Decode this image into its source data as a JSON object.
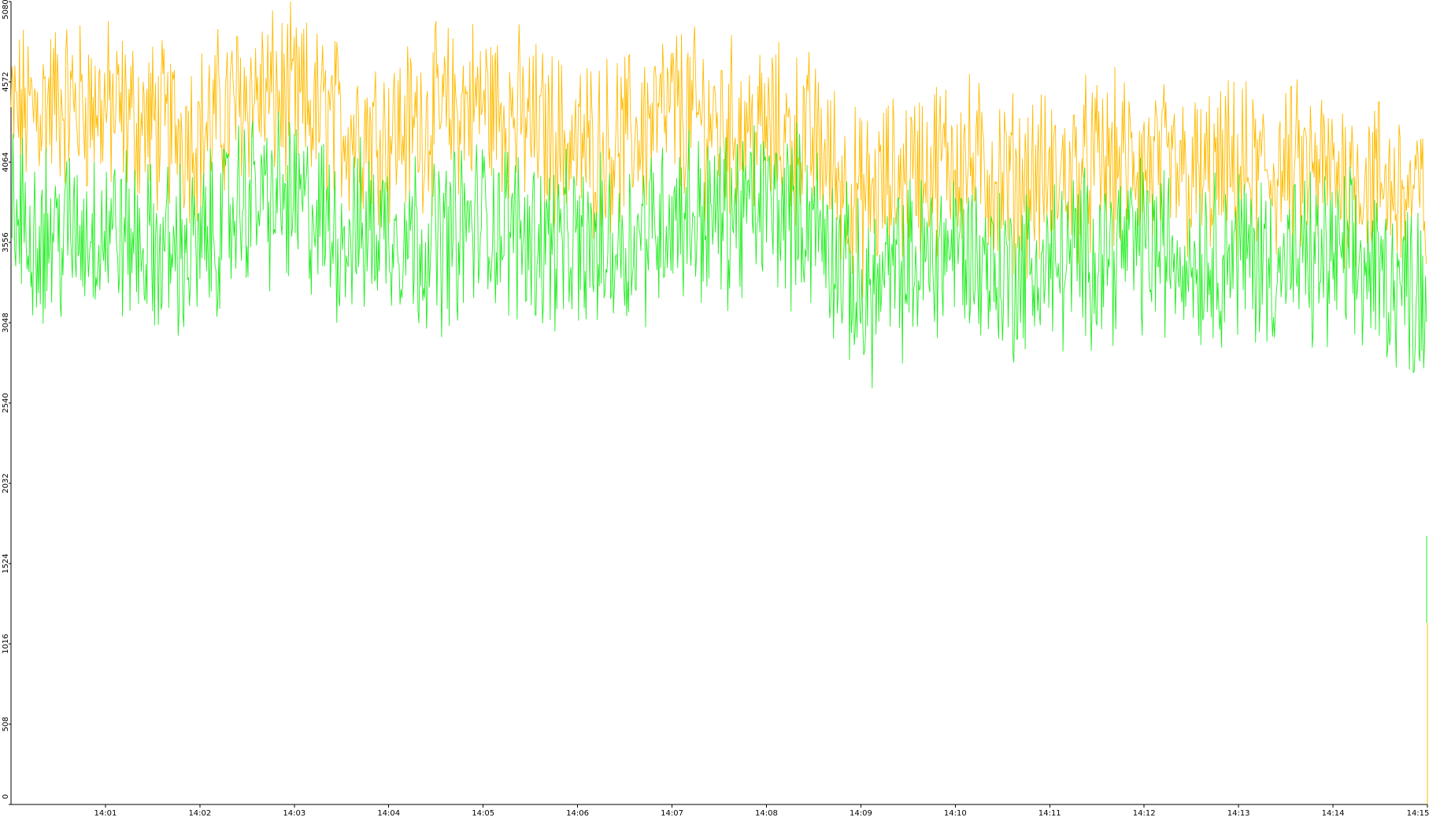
{
  "chart_data": {
    "type": "line",
    "title": "",
    "xlabel": "",
    "ylabel": "",
    "grid": false,
    "legend": "none",
    "x_range": [
      "14:00",
      "14:15"
    ],
    "ylim": [
      0,
      5080
    ],
    "y_ticks": [
      "0",
      "508",
      "1016",
      "1524",
      "2032",
      "2540",
      "3048",
      "3556",
      "4064",
      "4572",
      "5080"
    ],
    "x_ticks": [
      "14:01",
      "14:02",
      "14:03",
      "14:04",
      "14:05",
      "14:06",
      "14:07",
      "14:08",
      "14:09",
      "14:10",
      "14:11",
      "14:12",
      "14:13",
      "14:14",
      "14:15"
    ],
    "series": [
      {
        "color": "#ffbb00",
        "x": [
          "14:00",
          "14:00:30",
          "14:01",
          "14:01:30",
          "14:02",
          "14:02:30",
          "14:03",
          "14:03:30",
          "14:04",
          "14:04:30",
          "14:05",
          "14:05:30",
          "14:06",
          "14:06:30",
          "14:07",
          "14:07:30",
          "14:08",
          "14:08:30",
          "14:09",
          "14:09:30",
          "14:10",
          "14:10:30",
          "14:11",
          "14:11:30",
          "14:12",
          "14:12:30",
          "14:13",
          "14:13:30",
          "14:14",
          "14:14:30",
          "14:15"
        ],
        "values": [
          4350,
          4450,
          4400,
          4300,
          4250,
          4500,
          4450,
          4300,
          4250,
          4350,
          4450,
          4300,
          4150,
          4200,
          4400,
          4300,
          4250,
          4200,
          3800,
          4000,
          4100,
          3950,
          3950,
          4050,
          4050,
          3950,
          4000,
          4000,
          4000,
          3950,
          3800
        ]
      },
      {
        "color": "#22ee22",
        "x": [
          "14:00",
          "14:00:30",
          "14:01",
          "14:01:30",
          "14:02",
          "14:02:30",
          "14:03",
          "14:03:30",
          "14:04",
          "14:04:30",
          "14:05",
          "14:05:30",
          "14:06",
          "14:06:30",
          "14:07",
          "14:07:30",
          "14:08",
          "14:08:30",
          "14:09",
          "14:09:30",
          "14:10",
          "14:10:30",
          "14:11",
          "14:11:30",
          "14:12",
          "14:12:30",
          "14:13",
          "14:13:30",
          "14:14",
          "14:14:30",
          "14:15"
        ],
        "values": [
          3700,
          3600,
          3650,
          3500,
          3500,
          3850,
          3800,
          3600,
          3650,
          3550,
          3700,
          3600,
          3500,
          3550,
          3750,
          3700,
          3800,
          3700,
          3200,
          3400,
          3550,
          3350,
          3400,
          3500,
          3550,
          3450,
          3500,
          3400,
          3450,
          3350,
          3250
        ]
      }
    ]
  }
}
